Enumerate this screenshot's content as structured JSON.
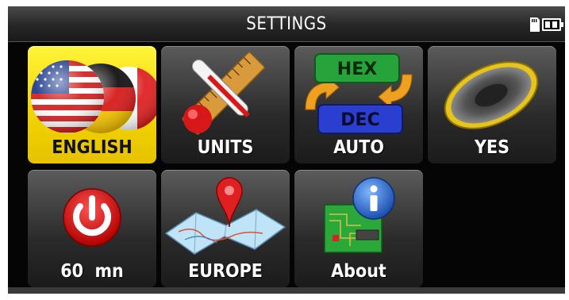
{
  "header": {
    "title": "SETTINGS"
  },
  "status": {
    "icons": [
      "sd-card-icon",
      "battery-icon"
    ]
  },
  "tiles": [
    {
      "label": "ENGLISH",
      "icon": "flags-icon",
      "selected": true
    },
    {
      "label": "UNITS",
      "icon": "units-icon"
    },
    {
      "label": "AUTO",
      "icon": "hex-dec-icon",
      "hex": "HEX",
      "dec": "DEC"
    },
    {
      "label": "YES",
      "icon": "speaker-icon"
    },
    {
      "label": "60  mn",
      "icon": "power-icon"
    },
    {
      "label": "EUROPE",
      "icon": "map-icon"
    },
    {
      "label": "About",
      "icon": "info-icon"
    }
  ],
  "colors": {
    "selected": "#f2d600",
    "tile": "#3a3a3a",
    "background": "#050505"
  }
}
